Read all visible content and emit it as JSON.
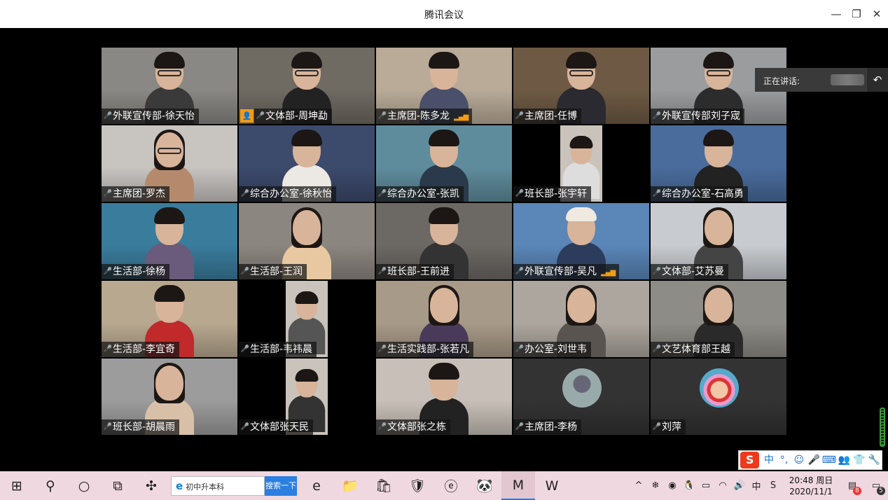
{
  "window": {
    "title": "腾讯会议",
    "minimize_glyph": "—",
    "restore_glyph": "❐",
    "close_glyph": "✕"
  },
  "speaker": {
    "label": "正在讲话:",
    "back_glyph": "↶"
  },
  "participants": [
    {
      "name": "外联宣传部-徐天怡",
      "scene": "#8a8884",
      "shirt": "#3a3a3a",
      "glasses": true
    },
    {
      "name": "文体部-周坤勐",
      "scene": "#6f6a62",
      "shirt": "#222",
      "glasses": true,
      "host": true
    },
    {
      "name": "主席团-陈多龙",
      "scene": "#b9ab98",
      "shirt": "#4a4f6a",
      "signal": true
    },
    {
      "name": "主席团-任博",
      "scene": "#6e5a44",
      "shirt": "#2a2a30",
      "glasses": true
    },
    {
      "name": "外联宣传部刘子宬",
      "scene": "#9a9c9e",
      "shirt": "#2c2c2c",
      "glasses": true
    },
    {
      "name": "主席团-罗杰",
      "scene": "#c8c4c0",
      "shirt": "#b58a6c",
      "glasses": true,
      "long_hair": true
    },
    {
      "name": "综合办公室-徐秋怡",
      "scene": "#3c4a6c",
      "shirt": "#ece8e4"
    },
    {
      "name": "综合办公室-张凯",
      "scene": "#5f8c9c",
      "shirt": "#2a3a4a"
    },
    {
      "name": "班长部-张宇轩",
      "scene": "#000000",
      "shirt": "#ddd",
      "narrow": true
    },
    {
      "name": "综合办公室-石高勇",
      "scene": "#4a6c9c",
      "shirt": "#222"
    },
    {
      "name": "生活部-徐杨",
      "scene": "#3a7c9c",
      "shirt": "#6a5a7c"
    },
    {
      "name": "生活部-王润",
      "scene": "#8c8680",
      "shirt": "#e8c8a0",
      "long_hair": true
    },
    {
      "name": "班长部-王前进",
      "scene": "#6c6864",
      "shirt": "#333"
    },
    {
      "name": "外联宣传部-吴凡",
      "scene": "#5a86b8",
      "shirt": "#2c3c5c",
      "signal": true,
      "cap": true
    },
    {
      "name": "文体部-艾苏曼",
      "scene": "#c8ccd0",
      "shirt": "#444",
      "long_hair": true
    },
    {
      "name": "生活部-李宜奇",
      "scene": "#b8a890",
      "shirt": "#c02a2a"
    },
    {
      "name": "生活部-韦祎晨",
      "scene": "#000000",
      "shirt": "#555",
      "narrow": true
    },
    {
      "name": "生活实践部-张若凡",
      "scene": "#a89a88",
      "shirt": "#4a3a5a",
      "long_hair": true
    },
    {
      "name": "办公室-刘世韦",
      "scene": "#aca69e",
      "shirt": "#5a5450",
      "long_hair": true
    },
    {
      "name": "文艺体育部王越",
      "scene": "#8e8c86",
      "shirt": "#2a2a2a",
      "long_hair": true
    },
    {
      "name": "班长部-胡晨雨",
      "scene": "#9c9c9c",
      "shirt": "#d8c0a8",
      "long_hair": true
    },
    {
      "name": "文体部张天民",
      "scene": "#000000",
      "shirt": "#333",
      "narrow": true
    },
    {
      "name": "文体部张之栋",
      "scene": "#c8c0b8",
      "shirt": "#222"
    },
    {
      "name": "主席团-李杨",
      "scene": "#333333",
      "avatar": "dark"
    },
    {
      "name": "刘萍",
      "scene": "#333333",
      "avatar": "cartoon"
    }
  ],
  "ime_bar": {
    "logo": "S",
    "items": [
      {
        "glyph": "中",
        "icon": "chinese-mode-icon"
      },
      {
        "glyph": "°,",
        "icon": "punctuation-icon"
      },
      {
        "glyph": "☺",
        "icon": "emoji-icon"
      },
      {
        "glyph": "🎤",
        "icon": "voice-input-icon"
      },
      {
        "glyph": "⌨",
        "icon": "keyboard-icon"
      },
      {
        "glyph": "👥",
        "icon": "user-icon"
      },
      {
        "glyph": "👕",
        "icon": "skin-icon"
      },
      {
        "glyph": "🔧",
        "icon": "tools-icon"
      }
    ]
  },
  "taskbar": {
    "start_glyph": "⊞",
    "search_glyph": "⚲",
    "cortana_glyph": "○",
    "taskview_glyph": "⧉",
    "search_box_text": "初中升本科",
    "search_button": "搜索一下",
    "apps": [
      {
        "glyph": "✣",
        "icon": "pinwheel-app-icon"
      },
      {
        "glyph": "e",
        "icon": "edge-browser-icon"
      },
      {
        "glyph": "📁",
        "icon": "file-explorer-icon"
      },
      {
        "glyph": "🛍",
        "icon": "store-icon"
      },
      {
        "glyph": "🛡",
        "icon": "security-app-icon"
      },
      {
        "glyph": "ⓔ",
        "icon": "ie-browser-icon"
      },
      {
        "glyph": "🐼",
        "icon": "panda-app-icon"
      },
      {
        "glyph": "M",
        "icon": "tencent-meeting-icon",
        "active": true
      },
      {
        "glyph": "W",
        "icon": "wps-icon"
      }
    ],
    "tray": [
      {
        "glyph": "^",
        "icon": "show-hidden-icons-icon"
      },
      {
        "glyph": "❄",
        "icon": "tray-snowflake-icon"
      },
      {
        "glyph": "◉",
        "icon": "tray-green-app-icon"
      },
      {
        "glyph": "🐧",
        "icon": "qq-icon"
      },
      {
        "glyph": "▭",
        "icon": "battery-icon"
      },
      {
        "glyph": "◠",
        "icon": "wifi-icon"
      },
      {
        "glyph": "🔊",
        "icon": "volume-icon"
      },
      {
        "glyph": "中",
        "icon": "input-language-icon"
      },
      {
        "glyph": "S",
        "icon": "sogou-tray-icon"
      }
    ],
    "clock_time": "20:48 周日",
    "clock_date": "2020/11/1",
    "notif_app_badge": "8",
    "action_center_badge": "5"
  }
}
